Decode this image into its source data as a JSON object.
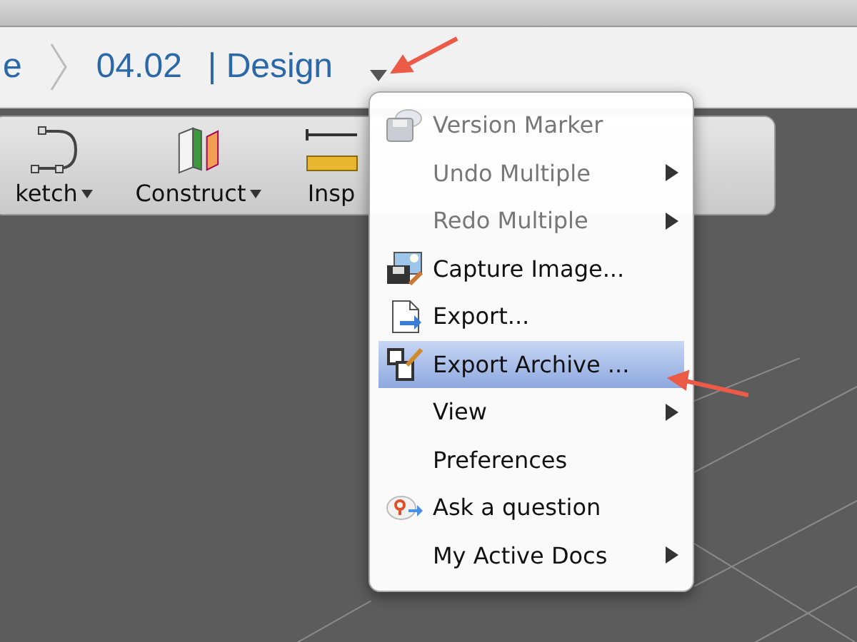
{
  "breadcrumb": [
    {
      "label": "e"
    },
    {
      "label": "04.02"
    },
    {
      "label": "| Design"
    }
  ],
  "toolbar": [
    {
      "label": "ketch",
      "dropdown": true
    },
    {
      "label": "Construct",
      "dropdown": true
    },
    {
      "label": "Insp",
      "dropdown": false
    }
  ],
  "menu": {
    "items": [
      {
        "label": "Version Marker",
        "disabled": true,
        "submenu": false,
        "selected": false
      },
      {
        "label": "Undo Multiple",
        "disabled": true,
        "submenu": true,
        "selected": false
      },
      {
        "label": "Redo Multiple",
        "disabled": true,
        "submenu": true,
        "selected": false
      },
      {
        "label": "Capture Image...",
        "disabled": false,
        "submenu": false,
        "selected": false
      },
      {
        "label": "Export...",
        "disabled": false,
        "submenu": false,
        "selected": false
      },
      {
        "label": "Export Archive ...",
        "disabled": false,
        "submenu": false,
        "selected": true
      },
      {
        "label": "View",
        "disabled": false,
        "submenu": true,
        "selected": false
      },
      {
        "label": "Preferences",
        "disabled": false,
        "submenu": false,
        "selected": false
      },
      {
        "label": "Ask a question",
        "disabled": false,
        "submenu": false,
        "selected": false
      },
      {
        "label": "My Active Docs",
        "disabled": false,
        "submenu": true,
        "selected": false
      }
    ]
  }
}
